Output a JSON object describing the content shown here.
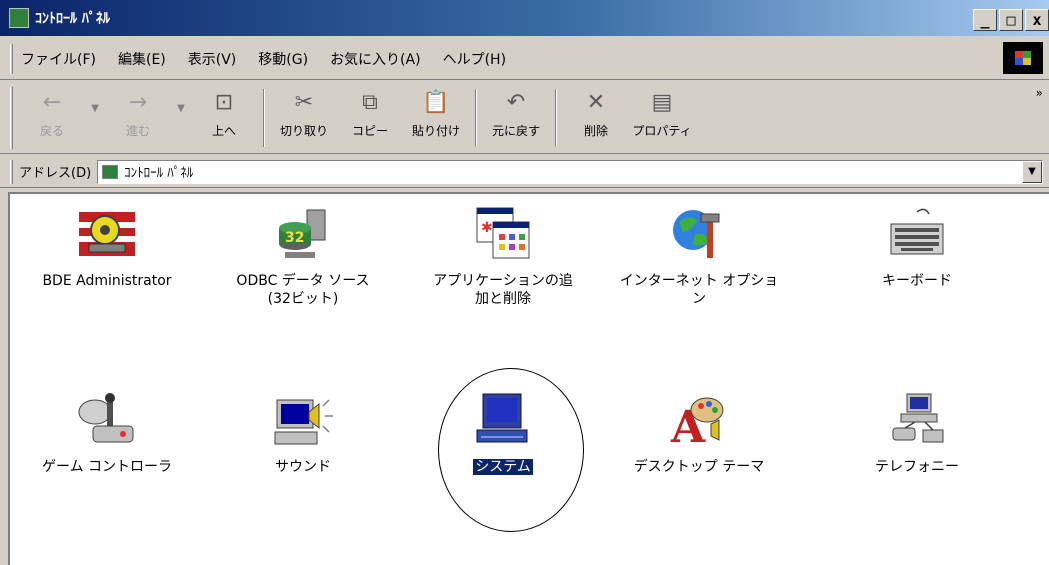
{
  "window": {
    "title": "ｺﾝﾄﾛｰﾙ ﾊﾟﾈﾙ",
    "controls": {
      "minimize": "_",
      "maximize": "□",
      "close": "x"
    }
  },
  "menu": [
    "ファイル(F)",
    "編集(E)",
    "表示(V)",
    "移動(G)",
    "お気に入り(A)",
    "ヘルプ(H)"
  ],
  "toolbar": [
    {
      "label": "戻る",
      "icon": "back-arrow-icon",
      "glyph": "←",
      "disabled": true
    },
    {
      "label": "進む",
      "icon": "forward-arrow-icon",
      "glyph": "→",
      "disabled": true
    },
    {
      "label": "上へ",
      "icon": "up-folder-icon",
      "glyph": "⊡",
      "disabled": false
    },
    {
      "label": "切り取り",
      "icon": "scissors-icon",
      "glyph": "✂",
      "disabled": false
    },
    {
      "label": "コピー",
      "icon": "copy-icon",
      "glyph": "⧉",
      "disabled": false
    },
    {
      "label": "貼り付け",
      "icon": "paste-icon",
      "glyph": "📋",
      "disabled": false
    },
    {
      "label": "元に戻す",
      "icon": "undo-icon",
      "glyph": "↶",
      "disabled": false
    },
    {
      "label": "削除",
      "icon": "delete-icon",
      "glyph": "✕",
      "disabled": false
    },
    {
      "label": "プロパティ",
      "icon": "properties-icon",
      "glyph": "▤",
      "disabled": false
    }
  ],
  "address": {
    "label": "アドレス(D)",
    "value": "ｺﾝﾄﾛｰﾙ ﾊﾟﾈﾙ"
  },
  "items": [
    {
      "label": "BDE Administrator",
      "icon": "bde-administrator-icon",
      "selected": false
    },
    {
      "label": "ODBC データ ソース\n(32ビット)",
      "icon": "odbc-data-source-icon",
      "selected": false
    },
    {
      "label": "アプリケーションの追\n加と削除",
      "icon": "add-remove-programs-icon",
      "selected": false
    },
    {
      "label": "インターネット オプショ\nン",
      "icon": "internet-options-icon",
      "selected": false
    },
    {
      "label": "キーボード",
      "icon": "keyboard-icon",
      "selected": false
    },
    {
      "label": "ゲーム コントローラ",
      "icon": "game-controller-icon",
      "selected": false
    },
    {
      "label": "サウンド",
      "icon": "sound-icon",
      "selected": false
    },
    {
      "label": "システム",
      "icon": "system-computer-icon",
      "selected": true
    },
    {
      "label": "デスクトップ テーマ",
      "icon": "desktop-theme-icon",
      "selected": false
    },
    {
      "label": "テレフォニー",
      "icon": "telephony-icon",
      "selected": false
    }
  ],
  "colors": {
    "titlebar_start": "#0a246a",
    "titlebar_end": "#a6caf0",
    "chrome": "#d4d0c8",
    "selection": "#0a246a"
  }
}
